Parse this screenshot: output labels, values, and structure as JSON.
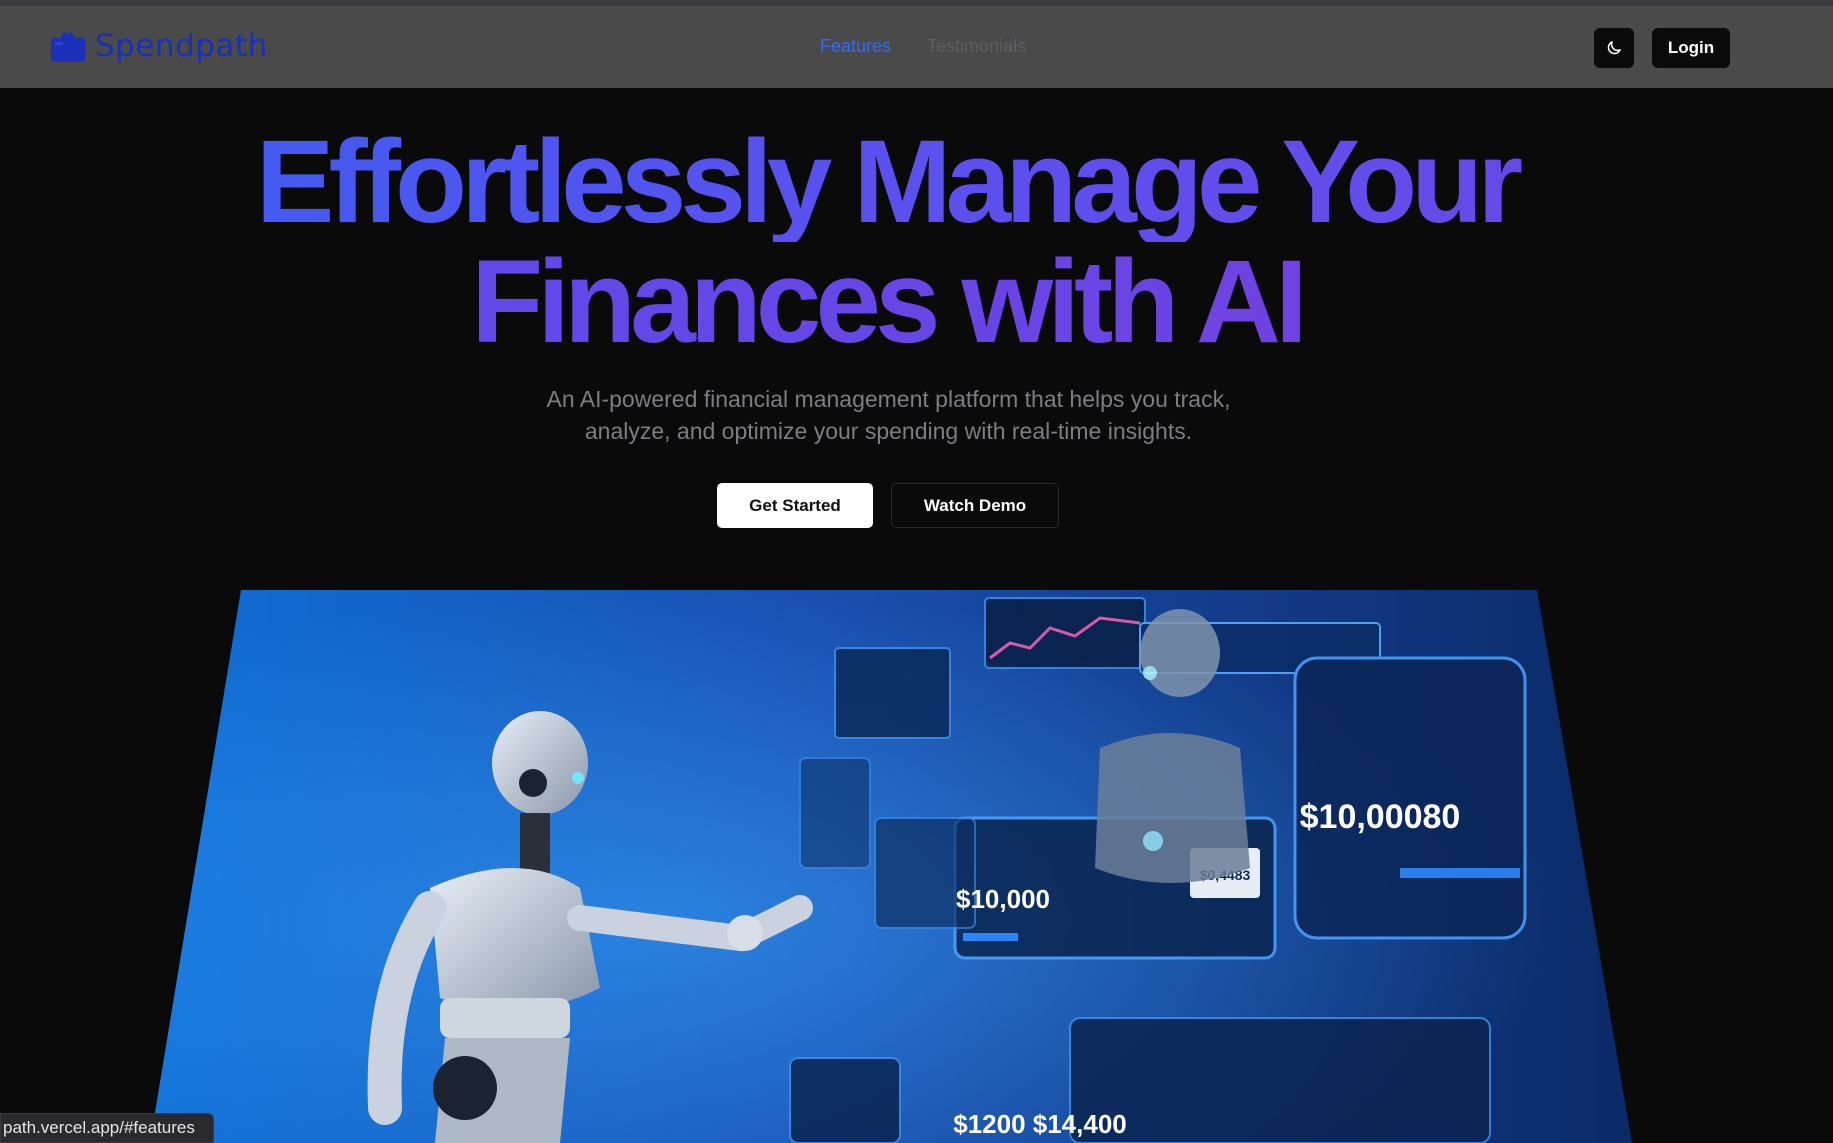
{
  "nav": {
    "brand": "Spendpath",
    "links": [
      {
        "label": "Features",
        "active": true
      },
      {
        "label": "Testimonials",
        "active": false
      }
    ],
    "login_label": "Login",
    "theme_icon": "moon-icon"
  },
  "hero": {
    "title_line_1": "Effortlessly Manage Your",
    "title_line_2": "Finances with AI",
    "subtitle": "An AI-powered financial management platform that helps you track, analyze, and optimize your spending with real-time insights.",
    "primary_cta": "Get Started",
    "secondary_cta": "Watch Demo"
  },
  "hero_image": {
    "panel_values": [
      "$10,00080",
      "$10,000",
      "$0,4483",
      "$1200 $14,400"
    ]
  },
  "status_bar": {
    "url": "path.vercel.app/#features"
  },
  "colors": {
    "brand": "#1a30b8",
    "accent": "#2f6bff",
    "gradient_start": "#3b5ef0",
    "gradient_end": "#7a3fdc",
    "background": "#0a0a0a"
  }
}
